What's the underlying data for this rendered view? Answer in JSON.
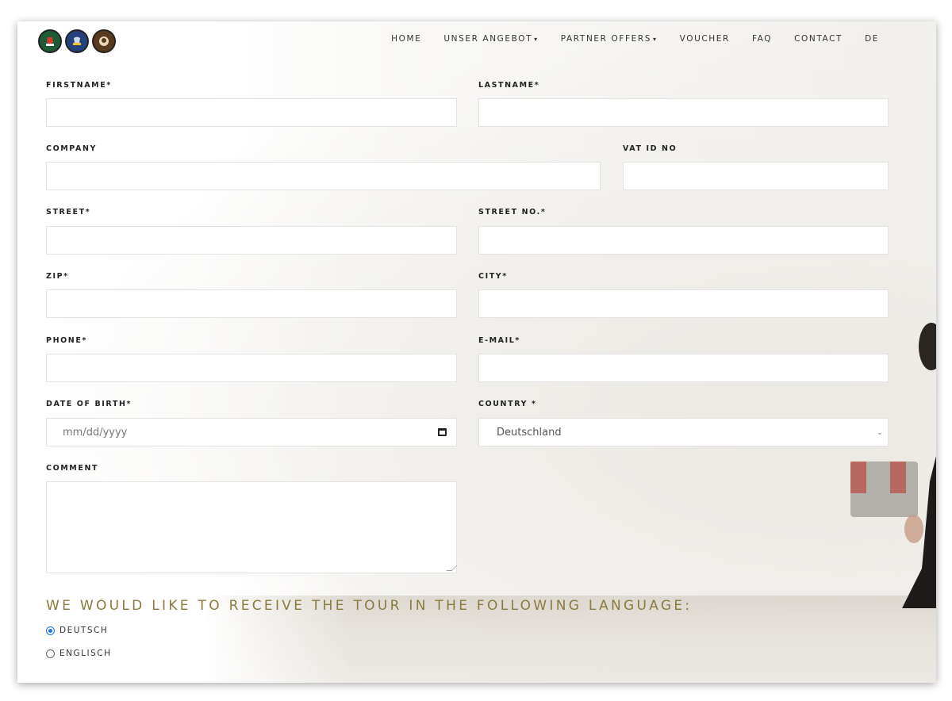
{
  "nav": {
    "items": [
      {
        "label": "HOME",
        "dropdown": false
      },
      {
        "label": "UNSER ANGEBOT",
        "dropdown": true
      },
      {
        "label": "PARTNER OFFERS",
        "dropdown": true
      },
      {
        "label": "VOUCHER",
        "dropdown": false
      },
      {
        "label": "FAQ",
        "dropdown": false
      },
      {
        "label": "CONTACT",
        "dropdown": false
      },
      {
        "label": "DE",
        "dropdown": false
      }
    ],
    "caret": "▾"
  },
  "form": {
    "firstname_label": "FIRSTNAME*",
    "lastname_label": "LASTNAME*",
    "company_label": "COMPANY",
    "vat_label": "VAT ID NO",
    "street_label": "STREET*",
    "street_no_label": "STREET NO.*",
    "zip_label": "ZIP*",
    "city_label": "CITY*",
    "phone_label": "PHONE*",
    "email_label": "E-MAIL*",
    "dob_label": "DATE OF BIRTH*",
    "dob_placeholder": "mm/dd/yyyy",
    "country_label": "COUNTRY *",
    "country_value": "Deutschland",
    "comment_label": "COMMENT"
  },
  "language": {
    "heading": "WE WOULD LIKE TO RECEIVE THE TOUR IN THE FOLLOWING LANGUAGE:",
    "options": [
      {
        "label": "DEUTSCH",
        "checked": true
      },
      {
        "label": "ENGLISCH",
        "checked": false
      }
    ]
  },
  "colors": {
    "heading_gold": "#8a7a3e",
    "radio_blue": "#1a73e8"
  }
}
